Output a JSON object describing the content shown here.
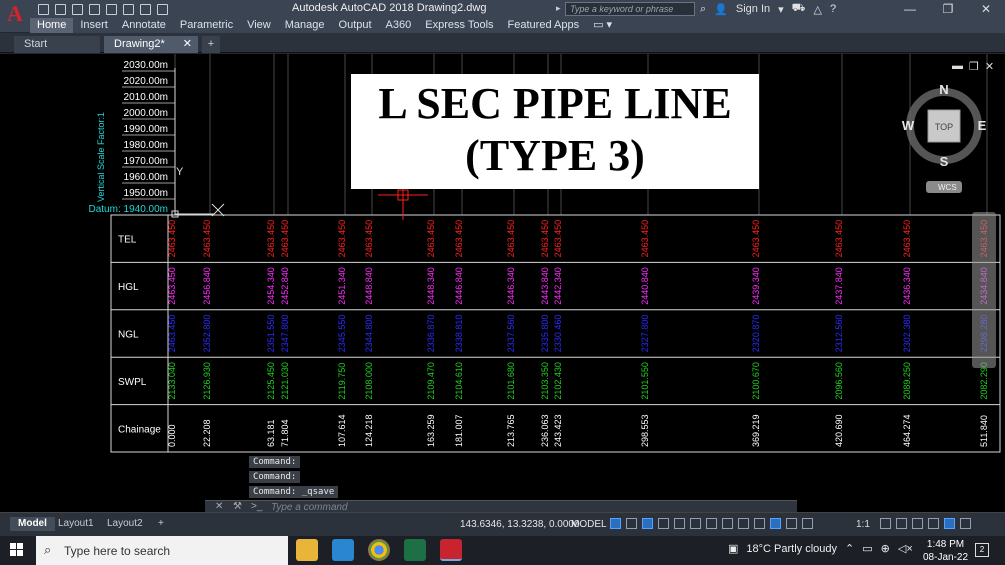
{
  "window": {
    "app_logo": "A",
    "title": "Autodesk AutoCAD 2018    Drawing2.dwg",
    "search_placeholder": "Type a keyword or phrase",
    "sign_in": "Sign In",
    "controls": {
      "minimize": "—",
      "restore": "❐",
      "close": "✕"
    }
  },
  "ribbon": {
    "tabs": [
      "Home",
      "Insert",
      "Annotate",
      "Parametric",
      "View",
      "Manage",
      "Output",
      "A360",
      "Express Tools",
      "Featured Apps"
    ],
    "active": 0
  },
  "doc_tabs": {
    "start": "Start",
    "drawing": "Drawing2*",
    "close": "✕",
    "plus": "+"
  },
  "drawing_title": {
    "line1": "L SEC PIPE LINE",
    "line2": "(TYPE 3)"
  },
  "viewcube": {
    "n": "N",
    "s": "S",
    "e": "E",
    "w": "W",
    "top": "TOP",
    "wcs": "WCS"
  },
  "elevations": [
    "2030.00m",
    "2020.00m",
    "2010.00m",
    "2000.00m",
    "1990.00m",
    "1980.00m",
    "1970.00m",
    "1960.00m",
    "1950.00m"
  ],
  "datum": "Datum: 1940.00m",
  "scale_factor": "Vertical Scale Factor:1",
  "axis_y": "Y",
  "table": {
    "rows": [
      "TEL",
      "HGL",
      "NGL",
      "SWPL",
      "Chainage"
    ],
    "columns": [
      {
        "tel": "2463.450",
        "hgl": "2463.450",
        "ngl": "2463.450",
        "swpl": "2133.040",
        "ch": "0.000"
      },
      {
        "tel": "2463.450",
        "hgl": "2456.840",
        "ngl": "2352.800",
        "swpl": "2126.930",
        "ch": "22.208"
      },
      {
        "tel": "2463.450",
        "hgl": "2454.340",
        "ngl": "2351.550",
        "swpl": "2125.450",
        "ch": "63.181"
      },
      {
        "tel": "2463.450",
        "hgl": "2452.840",
        "ngl": "2347.800",
        "swpl": "2121.030",
        "ch": "71.804"
      },
      {
        "tel": "2463.450",
        "hgl": "2451.340",
        "ngl": "2345.550",
        "swpl": "2119.750",
        "ch": "107.614"
      },
      {
        "tel": "2463.450",
        "hgl": "2448.840",
        "ngl": "2344.800",
        "swpl": "2108.000",
        "ch": "124.218"
      },
      {
        "tel": "2463.450",
        "hgl": "2448.340",
        "ngl": "2336.870",
        "swpl": "2109.470",
        "ch": "163.259"
      },
      {
        "tel": "2463.450",
        "hgl": "2446.840",
        "ngl": "2338.810",
        "swpl": "2104.610",
        "ch": "181.007"
      },
      {
        "tel": "2463.450",
        "hgl": "2446.340",
        "ngl": "2337.560",
        "swpl": "2101.680",
        "ch": "213.765"
      },
      {
        "tel": "2463.450",
        "hgl": "2443.840",
        "ngl": "2335.800",
        "swpl": "2103.350",
        "ch": "236.063"
      },
      {
        "tel": "2463.450",
        "hgl": "2442.340",
        "ngl": "2330.460",
        "swpl": "2102.430",
        "ch": "243.423"
      },
      {
        "tel": "2463.450",
        "hgl": "2440.840",
        "ngl": "2327.800",
        "swpl": "2101.550",
        "ch": "298.553"
      },
      {
        "tel": "2463.450",
        "hgl": "2439.340",
        "ngl": "2320.870",
        "swpl": "2100.670",
        "ch": "369.219"
      },
      {
        "tel": "2463.450",
        "hgl": "2437.840",
        "ngl": "2312.560",
        "swpl": "2096.560",
        "ch": "420.690"
      },
      {
        "tel": "2463.450",
        "hgl": "2436.340",
        "ngl": "2302.380",
        "swpl": "2089.250",
        "ch": "464.274"
      },
      {
        "tel": "2463.450",
        "hgl": "2434.840",
        "ngl": "2298.280",
        "swpl": "2082.290",
        "ch": "511.840"
      }
    ]
  },
  "command_history": [
    "Command:",
    "Command:",
    "Command: _qsave"
  ],
  "command_line": {
    "placeholder": "Type a command",
    "prompt": ">_"
  },
  "status": {
    "layout_tabs": [
      "Model",
      "Layout1",
      "Layout2"
    ],
    "plus": "+",
    "coordinates": "143.6346, 13.3238, 0.0000",
    "model": "MODEL",
    "scale": "1:1"
  },
  "taskbar": {
    "search_placeholder": "Type here to search",
    "weather": "18°C  Partly cloudy",
    "time": "1:48 PM",
    "date": "08-Jan-22",
    "notifications": "2"
  },
  "colors": {
    "tel": "#ff1f1f",
    "hgl": "#ff2bff",
    "ngl": "#2b2bff",
    "swpl": "#1fd11f",
    "ch": "#ffffff",
    "datum": "#1fd8d8"
  }
}
